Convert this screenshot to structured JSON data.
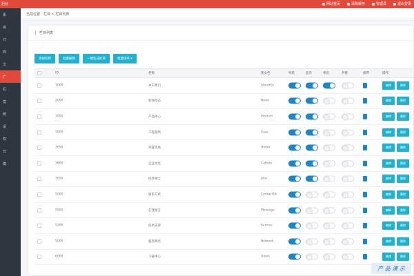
{
  "topbar": {
    "brand": "后台",
    "links": [
      {
        "label": "网站首页",
        "icon": "home-icon"
      },
      {
        "label": "清除缓存",
        "icon": "trash-icon"
      },
      {
        "label": "管理员",
        "icon": "user-icon"
      },
      {
        "label": "退出登录",
        "icon": "logout-icon"
      }
    ]
  },
  "sidebar": {
    "items": [
      "系",
      "会",
      "订",
      "商",
      "文",
      "广",
      "栏",
      "营",
      "统",
      "设",
      "权",
      "日",
      "模"
    ],
    "active_index": 5
  },
  "breadcrumb": "当前位置：栏目 > 栏目列表",
  "panel_title": "栏目列表",
  "toolbar": {
    "buttons": [
      "添加栏目",
      "批量删除",
      "一键生成栏目",
      "批量操作 ▾"
    ]
  },
  "table": {
    "headers": [
      "",
      "ID",
      "名称",
      "英文名",
      "导航",
      "显示",
      "单页",
      "外链",
      "排序",
      "操作"
    ],
    "rows": [
      {
        "id": "1000",
        "name": "关于我们",
        "en": "AboutUs",
        "nav": true,
        "show": true,
        "single": true,
        "ext": false
      },
      {
        "id": "2000",
        "name": "新闻动态",
        "en": "News",
        "nav": true,
        "show": true,
        "single": false,
        "ext": false
      },
      {
        "id": "3000",
        "name": "产品中心",
        "en": "Product",
        "nav": true,
        "show": true,
        "single": false,
        "ext": false
      },
      {
        "id": "3000",
        "name": "工程案例",
        "en": "Case",
        "nav": true,
        "show": true,
        "single": false,
        "ext": false
      },
      {
        "id": "3050",
        "name": "荣誉资质",
        "en": "Honor",
        "nav": true,
        "show": true,
        "single": false,
        "ext": false
      },
      {
        "id": "3600",
        "name": "企业文化",
        "en": "Culture",
        "nav": true,
        "show": true,
        "single": false,
        "ext": false
      },
      {
        "id": "3050",
        "name": "招贤纳士",
        "en": "Jobs",
        "nav": true,
        "show": true,
        "single": false,
        "ext": false
      },
      {
        "id": "5000",
        "name": "联系方式",
        "en": "ContactUs",
        "nav": true,
        "show": false,
        "single": false,
        "ext": false
      },
      {
        "id": "5500",
        "name": "在线留言",
        "en": "Message",
        "nav": true,
        "show": false,
        "single": false,
        "ext": false
      },
      {
        "id": "5200",
        "name": "技术支持",
        "en": "Service",
        "nav": true,
        "show": false,
        "single": false,
        "ext": false
      },
      {
        "id": "5000",
        "name": "服务网点",
        "en": "Network",
        "nav": true,
        "show": false,
        "single": false,
        "ext": false
      },
      {
        "id": "6000",
        "name": "下载中心",
        "en": "Down",
        "nav": true,
        "show": false,
        "single": false,
        "ext": false
      }
    ],
    "action_labels": [
      "编辑",
      "删除"
    ]
  },
  "watermark": "产 品 演 示",
  "colors": {
    "topbar": "#e1493b",
    "sidebar": "#2e3640",
    "accent": "#1fb2cf",
    "switch_on": "#1b86c8"
  }
}
